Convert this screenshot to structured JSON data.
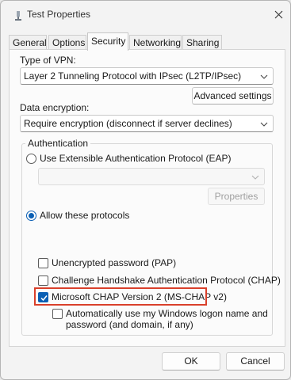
{
  "window": {
    "title": "Test Properties"
  },
  "tabs": [
    "General",
    "Options",
    "Security",
    "Networking",
    "Sharing"
  ],
  "active_tab": "Security",
  "security": {
    "vpn_type_label": "Type of VPN:",
    "vpn_type_value": "Layer 2 Tunneling Protocol with IPsec (L2TP/IPsec)",
    "advanced_settings": "Advanced settings",
    "encryption_label": "Data encryption:",
    "encryption_value": "Require encryption (disconnect if server declines)",
    "auth_group_title": "Authentication",
    "eap_option": "Use Extensible Authentication Protocol (EAP)",
    "eap_select_value": "",
    "properties_button": "Properties",
    "allow_protocols_option": "Allow these protocols",
    "protocols": {
      "pap": "Unencrypted password (PAP)",
      "chap": "Challenge Handshake Authentication Protocol (CHAP)",
      "mschapv2": "Microsoft CHAP Version 2 (MS-CHAP v2)",
      "auto_logon_line1": "Automatically use my Windows logon name and",
      "auto_logon_line2": "password (and domain, if any)"
    },
    "state": {
      "eap_selected": false,
      "allow_protocols_selected": true,
      "pap_checked": false,
      "chap_checked": false,
      "mschapv2_checked": true,
      "auto_logon_checked": false
    }
  },
  "footer": {
    "ok": "OK",
    "cancel": "Cancel"
  },
  "colors": {
    "accent": "#0a5fb4",
    "highlight_border": "#d9402b"
  },
  "icons": {
    "title": "network-connection-icon",
    "close": "close-icon",
    "dropdown": "chevron-down-icon",
    "check": "check-icon"
  }
}
